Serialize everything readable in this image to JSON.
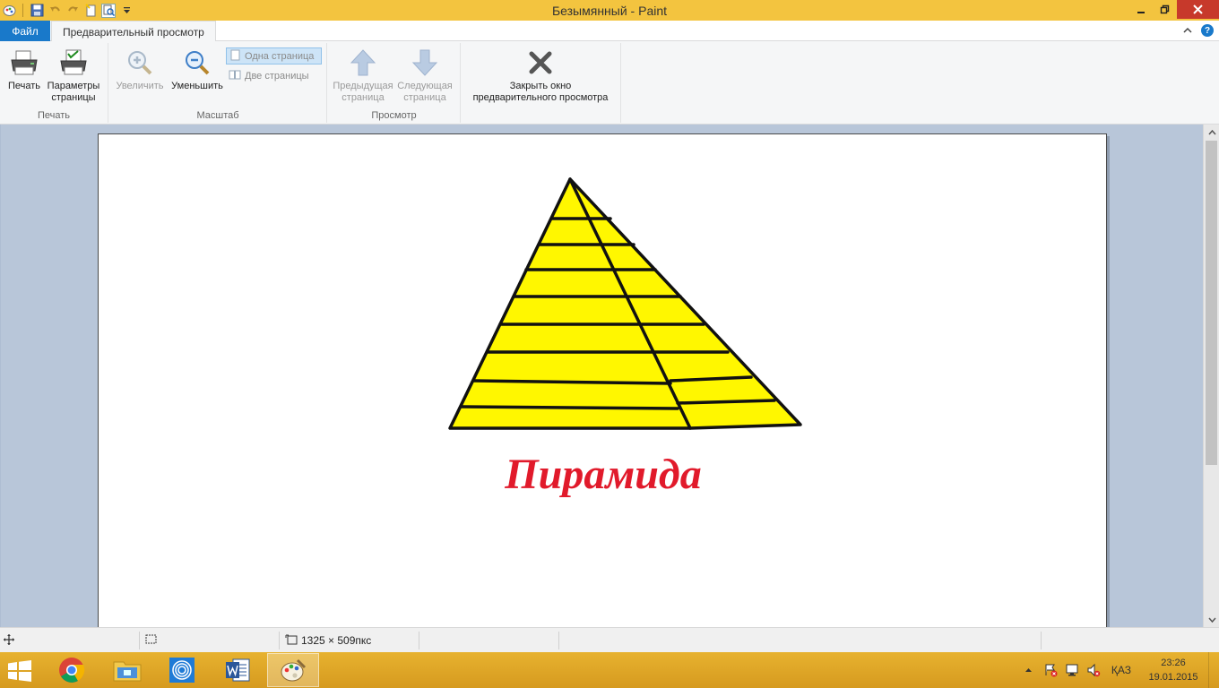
{
  "window": {
    "title": "Безымянный - Paint"
  },
  "tabs": {
    "file": "Файл",
    "preview": "Предварительный просмотр"
  },
  "ribbon": {
    "print_group": {
      "label": "Печать",
      "print": "Печать",
      "page_setup": "Параметры страницы"
    },
    "zoom_group": {
      "label": "Масштаб",
      "zoom_in": "Увеличить",
      "zoom_out": "Уменьшить",
      "one_page": "Одна страница",
      "two_pages": "Две страницы"
    },
    "preview_group": {
      "label": "Просмотр",
      "prev_page": "Предыдущая страница",
      "next_page": "Следующая страница"
    },
    "close_preview": "Закрыть окно предварительного просмотра"
  },
  "canvas": {
    "caption": "Пирамида",
    "caption_color": "#e11a2b",
    "fill_color": "#fff700"
  },
  "statusbar": {
    "dimensions": "1325 × 509пкс"
  },
  "taskbar": {
    "apps": [
      "chrome-icon",
      "file-explorer-icon",
      "media-icon",
      "word-icon",
      "paint-icon"
    ],
    "lang": "ҚАЗ",
    "time": "23:26",
    "date": "19.01.2015"
  }
}
